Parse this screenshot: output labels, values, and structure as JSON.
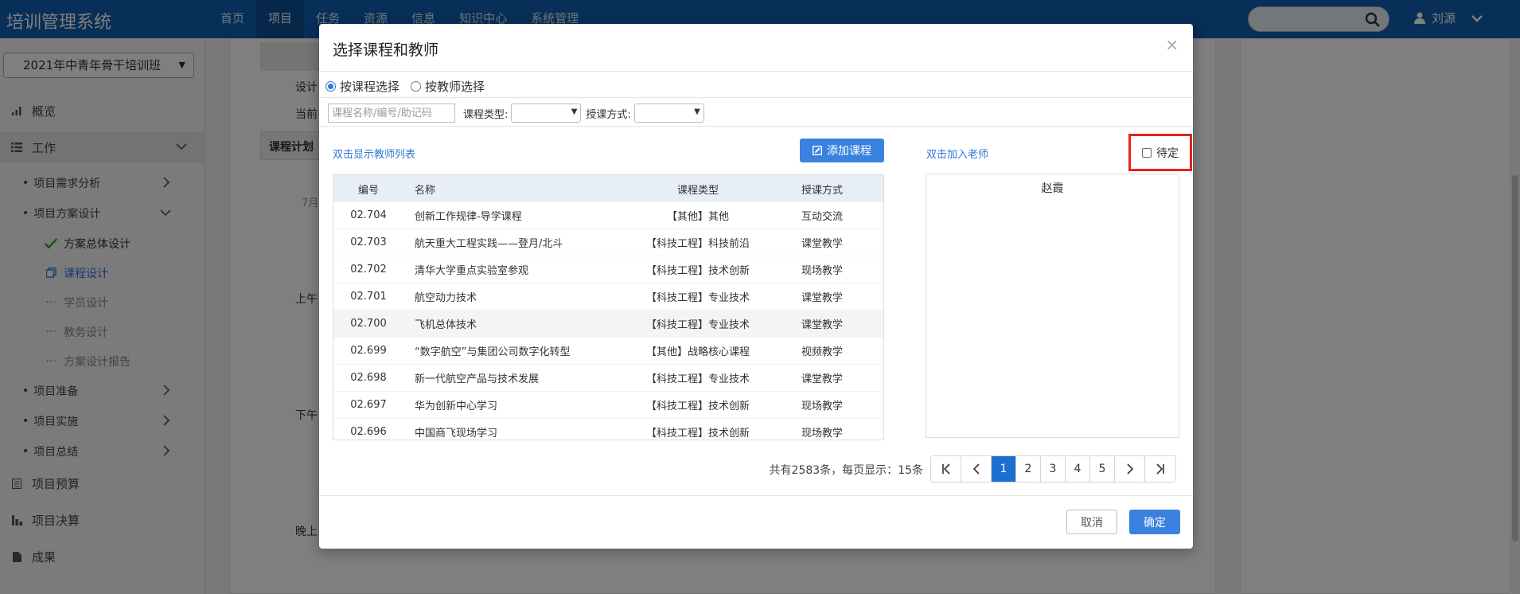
{
  "app": {
    "title": "培训管理系统"
  },
  "topnav": [
    "首页",
    "项目",
    "任务",
    "资源",
    "信息",
    "知识中心",
    "系统管理"
  ],
  "user": {
    "name": "刘源"
  },
  "sidebar": {
    "project": "2021年中青年骨干培训班",
    "overview": "概览",
    "work": "工作",
    "items": [
      {
        "label": "项目需求分析"
      },
      {
        "label": "项目方案设计"
      },
      {
        "label": "项目准备"
      },
      {
        "label": "项目实施"
      },
      {
        "label": "项目总结"
      }
    ],
    "leaves": [
      {
        "label": "方案总体设计"
      },
      {
        "label": "课程设计"
      },
      {
        "label": "学员设计"
      },
      {
        "label": "教务设计"
      },
      {
        "label": "方案设计报告"
      }
    ],
    "budget": "项目预算",
    "settle": "项目决算",
    "result": "成果"
  },
  "background": {
    "design": "设计",
    "current": "当前",
    "plan": "课程计划",
    "month": "7月",
    "morning": "上午",
    "afternoon": "下午",
    "evening": "晚上"
  },
  "modal": {
    "title": "选择课程和教师",
    "close": "×",
    "radio_course": "按课程选择",
    "radio_teacher": "按教师选择",
    "search_placeholder": "课程名称/编号/助记码",
    "type_label": "课程类型:",
    "mode_label": "授课方式:",
    "hint_teacher_list": "双击显示教师列表",
    "add_course": "添加课程",
    "hint_add_teacher": "双击加入老师",
    "pending": "待定",
    "columns": [
      "编号",
      "名称",
      "课程类型",
      "授课方式"
    ],
    "rows": [
      {
        "code": "02.704",
        "name": "创新工作规律-导学课程",
        "type": "【其他】其他",
        "mode": "互动交流"
      },
      {
        "code": "02.703",
        "name": "航天重大工程实践——登月/北斗",
        "type": "【科技工程】科技前沿",
        "mode": "课堂教学"
      },
      {
        "code": "02.702",
        "name": "清华大学重点实验室参观",
        "type": "【科技工程】技术创新",
        "mode": "现场教学"
      },
      {
        "code": "02.701",
        "name": "航空动力技术",
        "type": "【科技工程】专业技术",
        "mode": "课堂教学"
      },
      {
        "code": "02.700",
        "name": "飞机总体技术",
        "type": "【科技工程】专业技术",
        "mode": "课堂教学"
      },
      {
        "code": "02.699",
        "name": "“数字航空”与集团公司数字化转型",
        "type": "【其他】战略核心课程",
        "mode": "视频教学"
      },
      {
        "code": "02.698",
        "name": "新一代航空产品与技术发展",
        "type": "【科技工程】专业技术",
        "mode": "课堂教学"
      },
      {
        "code": "02.697",
        "name": "华为创新中心学习",
        "type": "【科技工程】技术创新",
        "mode": "现场教学"
      },
      {
        "code": "02.696",
        "name": "中国商飞现场学习",
        "type": "【科技工程】技术创新",
        "mode": "现场教学"
      }
    ],
    "teacher": "赵霞",
    "pager_info": "共有2583条，每页显示：15条",
    "pages": [
      "1",
      "2",
      "3",
      "4",
      "5"
    ],
    "cancel": "取消",
    "ok": "确定"
  },
  "colors": {
    "brand": "#0f5fae",
    "primary": "#3b82e0",
    "highlight": "#e8231b"
  },
  "icons": [
    "search-icon",
    "user-icon",
    "chevron-down-icon",
    "chart-icon",
    "list-icon",
    "check-icon",
    "copy-icon",
    "edit-icon",
    "first-page-icon",
    "prev-page-icon",
    "next-page-icon",
    "last-page-icon"
  ]
}
